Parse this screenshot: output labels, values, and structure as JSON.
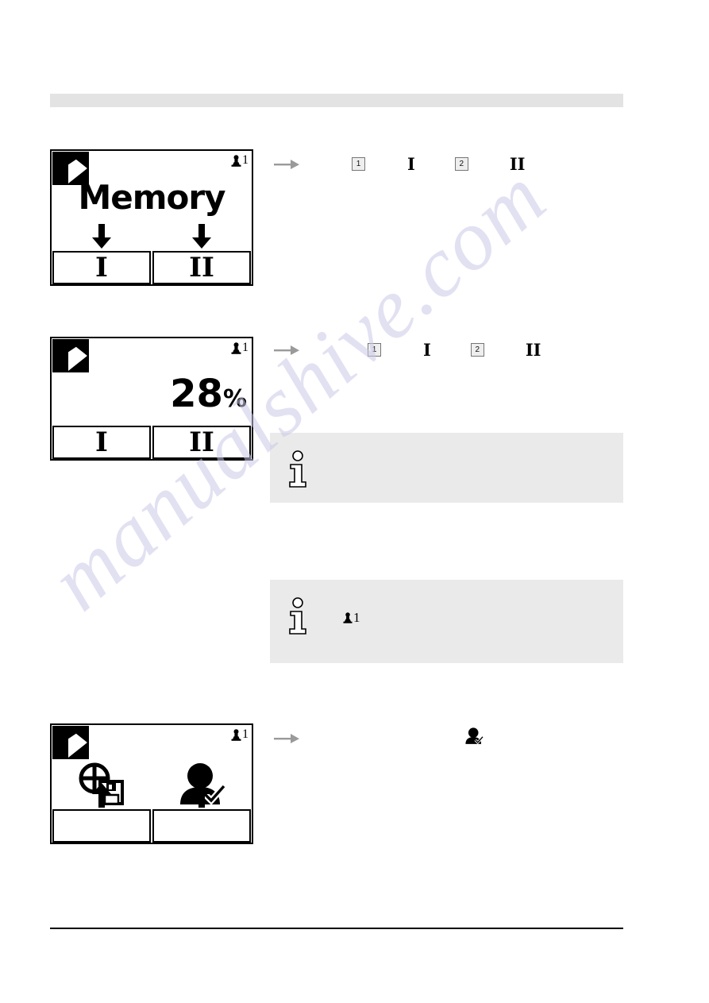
{
  "page": {
    "watermark_text": "manualshive.com",
    "header_band": "",
    "footer_rule": ""
  },
  "colors": {
    "band_gray": "#e3e3e3",
    "note_gray": "#eaeaea",
    "keybox_fill": "#eeeeee",
    "keybox_border": "#767676",
    "arrow_gray": "#9a9a9a",
    "ink": "#000000",
    "watermark": "#c9c9e8"
  },
  "displays": [
    {
      "name": "memory-screen",
      "logo_icon": "k-logo-icon",
      "status": {
        "icon": "user-pawn-icon",
        "value": "1"
      },
      "title": "Memory",
      "arrows": [
        "down-arrow-icon",
        "down-arrow-icon"
      ],
      "softkeys": [
        "I",
        "II"
      ]
    },
    {
      "name": "percent-screen",
      "logo_icon": "k-logo-icon",
      "status": {
        "icon": "user-pawn-icon",
        "value": "1"
      },
      "value": "28",
      "unit": "%",
      "softkeys": [
        "I",
        "II"
      ]
    },
    {
      "name": "save-recall-screen",
      "logo_icon": "k-logo-icon",
      "status": {
        "icon": "user-pawn-icon",
        "value": "1"
      },
      "icons": [
        "target-save-icon",
        "user-check-icon"
      ],
      "arrows": [
        "up-arrow-icon",
        "up-arrow-icon"
      ],
      "softkeys": [
        "",
        ""
      ]
    }
  ],
  "steps": [
    {
      "name": "step-memory",
      "arrow_icon": "gray-right-arrow-icon",
      "items": [
        {
          "type": "keybox",
          "label": "1"
        },
        {
          "type": "roman",
          "label": "I"
        },
        {
          "type": "keybox",
          "label": "2"
        },
        {
          "type": "roman",
          "label": "II"
        }
      ]
    },
    {
      "name": "step-percent",
      "arrow_icon": "gray-right-arrow-icon",
      "items": [
        {
          "type": "keybox",
          "label": "1"
        },
        {
          "type": "roman",
          "label": "I"
        },
        {
          "type": "keybox",
          "label": "2"
        },
        {
          "type": "roman",
          "label": "II"
        }
      ]
    },
    {
      "name": "step-recall",
      "arrow_icon": "gray-right-arrow-icon",
      "items": [
        {
          "type": "icon",
          "label": "user-check-icon"
        }
      ]
    }
  ],
  "notes": [
    {
      "name": "note-one",
      "icon": "info-icon",
      "text": ""
    },
    {
      "name": "note-two",
      "icon": "info-icon",
      "symbol_icon": "user-pawn-icon",
      "symbol_value": "1",
      "text": ""
    }
  ]
}
